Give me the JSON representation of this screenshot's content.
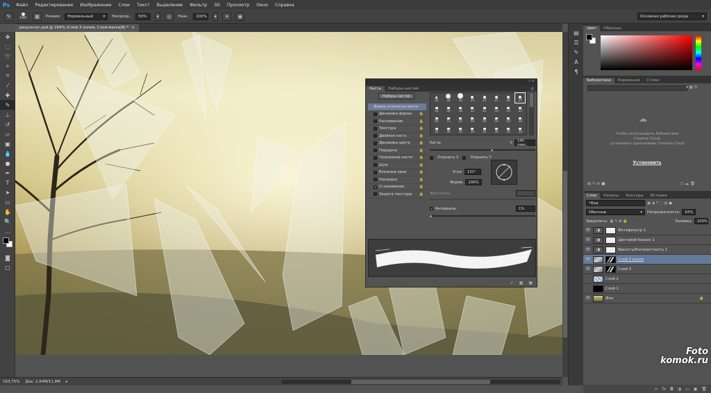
{
  "app": {
    "logo": "Ps"
  },
  "menu": [
    "Файл",
    "Редактирование",
    "Изображение",
    "Слои",
    "Текст",
    "Выделение",
    "Фильтр",
    "3D",
    "Просмотр",
    "Окно",
    "Справка"
  ],
  "options": {
    "size": "140",
    "mode_label": "Режим:",
    "mode_value": "Нормальный",
    "opacity_label": "Непрозр.:",
    "opacity_value": "50%",
    "pressure_label": "Наж.:",
    "pressure_value": "100%",
    "workspace": "Основная рабочая среда"
  },
  "doc_tab": {
    "title": "результат.psd @ 164% (Слой 3 копия, Слой-маска/8) *",
    "close": "×"
  },
  "status": {
    "zoom": "163,75%",
    "doc": "Док: 2,64М/11,8М"
  },
  "color_panel": {
    "tabs": [
      "Цвет",
      "Образцы"
    ]
  },
  "libraries": {
    "tabs": [
      "Библиотеки",
      "Коррекция",
      "Стили"
    ],
    "message_lines": [
      "Чтобы использовать библиотеки",
      "Creative Cloud,",
      "установите приложение Creative Cloud"
    ],
    "install": "Установить"
  },
  "layers_panel": {
    "tabs": [
      "Слои",
      "Каналы",
      "Контуры",
      "История"
    ],
    "filter": "Вид",
    "blend": "Обычные",
    "opacity_label": "Непрозрачность:",
    "opacity": "63%",
    "lock_label": "Закрепить:",
    "fill_label": "Заливка:",
    "fill": "100%",
    "layers": [
      {
        "name": "Фотофильтр 1",
        "kind": "adj"
      },
      {
        "name": "Цветовой баланс 1",
        "kind": "adj"
      },
      {
        "name": "Яркость/Контрастность 1",
        "kind": "adj"
      },
      {
        "name": "Слой 3 копия",
        "kind": "img",
        "selected": true
      },
      {
        "name": "Слой 3",
        "kind": "img"
      },
      {
        "name": "Слой 2",
        "kind": "pix"
      },
      {
        "name": "Слой 1",
        "kind": "black"
      },
      {
        "name": "Фон",
        "kind": "bg"
      }
    ]
  },
  "brush_panel": {
    "tabs": [
      "Кисть",
      "Наборы кистей"
    ],
    "presets_button": "Наборы кистей",
    "options": [
      {
        "label": "Форма отпечатка кисти",
        "active": true,
        "check": false,
        "lock": false
      },
      {
        "label": "Динамика формы",
        "check": false,
        "lock": true
      },
      {
        "label": "Рассеивание",
        "check": false,
        "lock": true
      },
      {
        "label": "Текстура",
        "check": false,
        "lock": true
      },
      {
        "label": "Двойная кисть",
        "check": false,
        "lock": true
      },
      {
        "label": "Динамика цвета",
        "check": false,
        "lock": true
      },
      {
        "label": "Передача",
        "check": false,
        "lock": true
      },
      {
        "label": "Положение кисти",
        "check": false,
        "lock": true
      },
      {
        "label": "Шум",
        "check": false,
        "lock": true
      },
      {
        "label": "Влажные края",
        "check": false,
        "lock": true
      },
      {
        "label": "Накладка",
        "check": false,
        "lock": true
      },
      {
        "label": "Сглаживание",
        "check": true,
        "lock": true
      },
      {
        "label": "Защита текстуры",
        "check": false,
        "lock": true
      }
    ],
    "tips_rows": [
      [
        "30",
        "30",
        "30",
        "25",
        "25",
        "25",
        "36",
        "25"
      ],
      [
        "36",
        "36",
        "36",
        "32",
        "25",
        "50",
        "25",
        "25"
      ],
      [
        "50",
        "71",
        "25",
        "50",
        "50",
        "50",
        "50",
        "36"
      ],
      [
        "36",
        "36",
        "36",
        "36",
        "36",
        "36",
        "36",
        "36"
      ]
    ],
    "size_label": "Кегль",
    "size_value": "140 пикс.",
    "flip_x": "Отразить X",
    "flip_y": "Отразить Y",
    "angle_label": "Угол:",
    "angle_value": "131°",
    "roundness_label": "Форма:",
    "roundness_value": "100%",
    "hardness_label": "Жесткость",
    "spacing_label": "Интервалы",
    "spacing_value": "1%"
  },
  "watermark": {
    "line1": "Foto",
    "line2": "komok.ru"
  }
}
